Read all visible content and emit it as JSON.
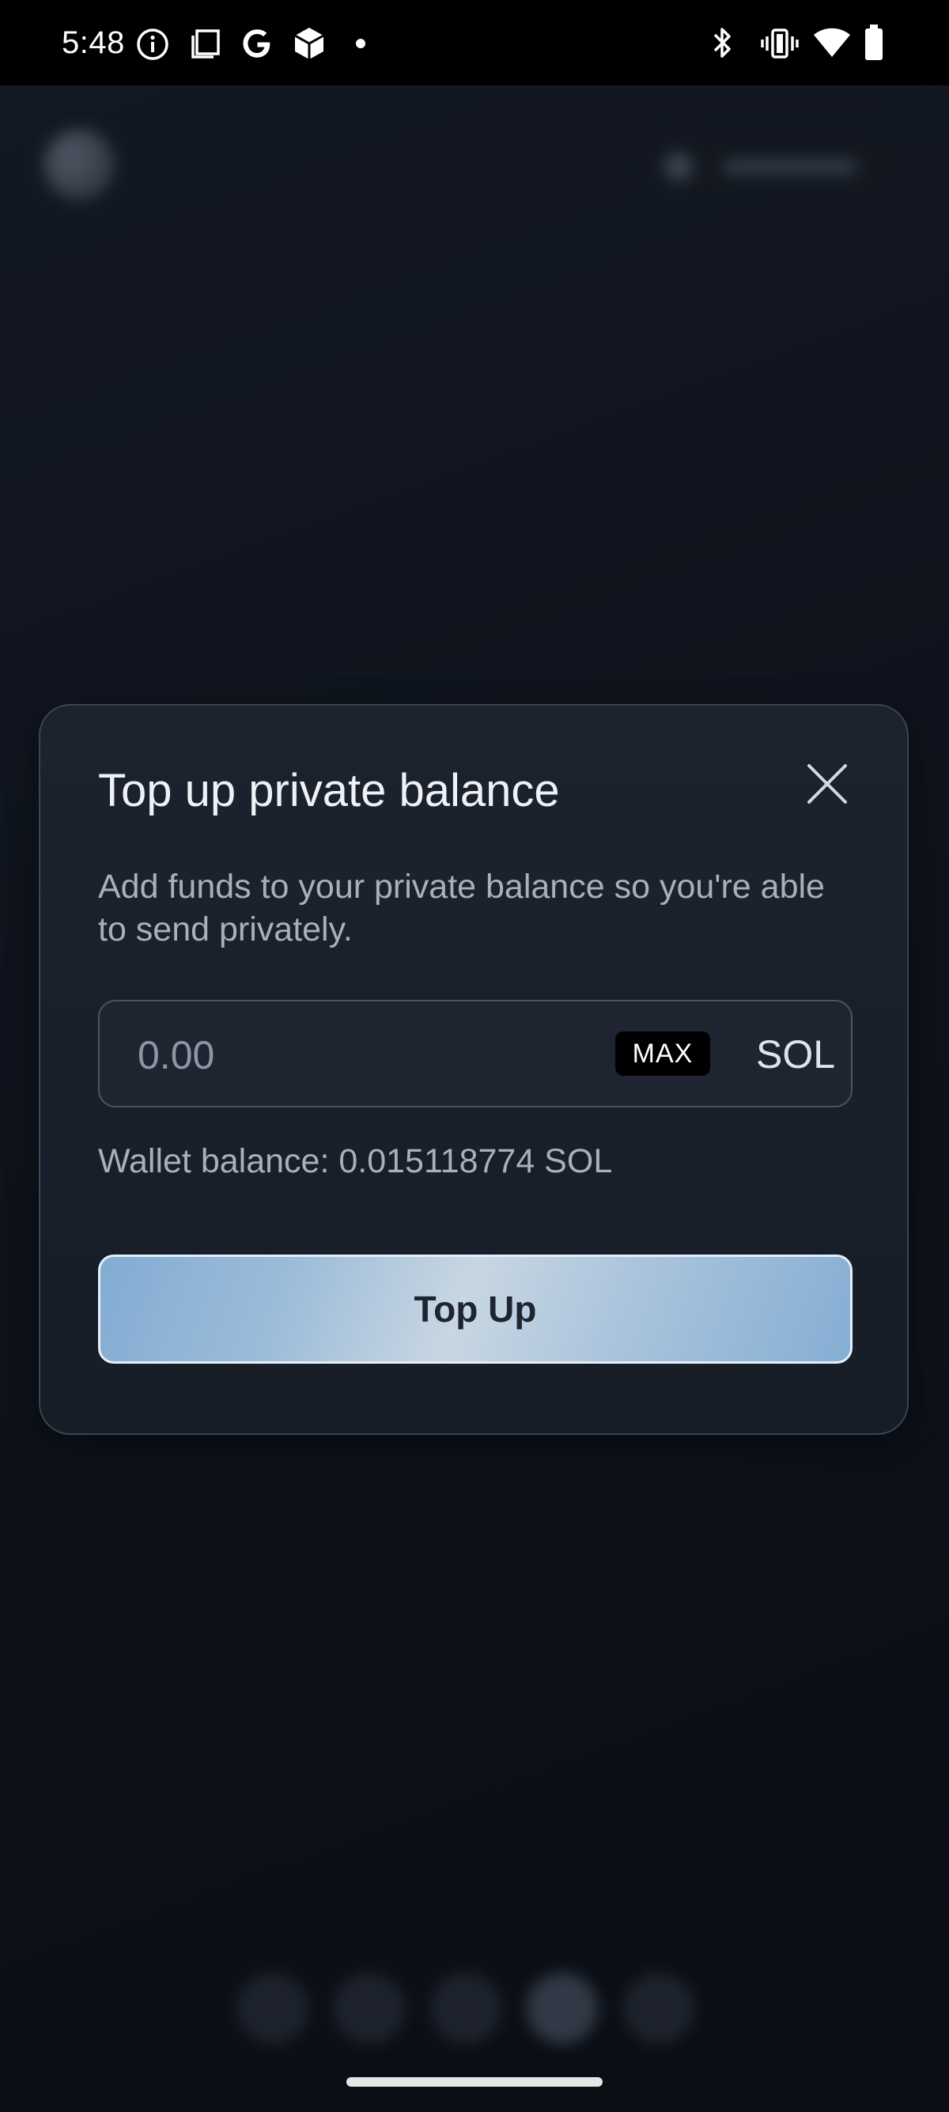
{
  "status_bar": {
    "time": "5:48",
    "left_icons": [
      "info-icon",
      "copy-icon",
      "google-icon",
      "cube-icon",
      "dot-icon"
    ],
    "right_icons": [
      "bluetooth-icon",
      "vibrate-icon",
      "wifi-icon",
      "battery-icon"
    ]
  },
  "modal": {
    "title": "Top up private balance",
    "description": "Add funds to your private balance so you're able to send privately.",
    "amount": {
      "value": "",
      "placeholder": "0.00",
      "max_label": "MAX",
      "currency": "SOL"
    },
    "wallet_balance": "Wallet balance: 0.015118774 SOL",
    "submit_label": "Top Up",
    "close_icon": "close-icon"
  },
  "colors": {
    "background": "#141a25",
    "modal_background": "#1a212b",
    "button_gradient_start": "#82acd3",
    "button_gradient_mid": "#c8d6e2",
    "max_badge": "#000000"
  }
}
